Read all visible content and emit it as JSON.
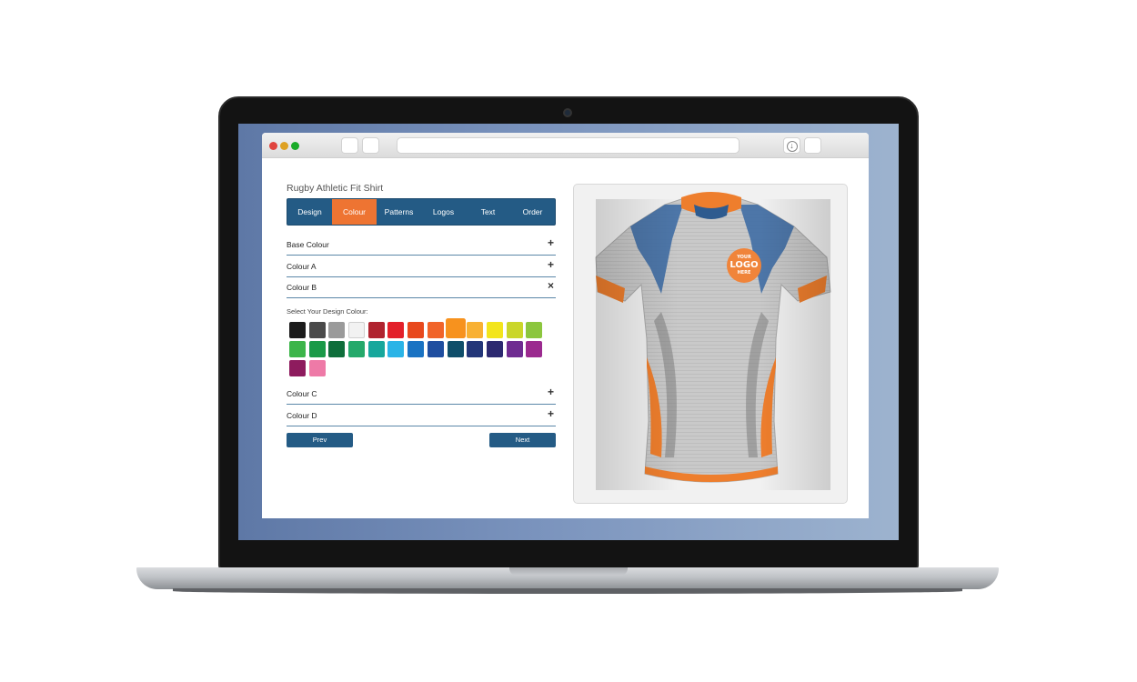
{
  "product": {
    "title": "Rugby Athletic Fit Shirt"
  },
  "tabs": [
    {
      "label": "Design",
      "active": false
    },
    {
      "label": "Colour",
      "active": true
    },
    {
      "label": "Patterns",
      "active": false
    },
    {
      "label": "Logos",
      "active": false
    },
    {
      "label": "Text",
      "active": false
    },
    {
      "label": "Order",
      "active": false
    }
  ],
  "accordion": {
    "base": {
      "label": "Base Colour",
      "toggle": "+"
    },
    "a": {
      "label": "Colour A",
      "toggle": "+"
    },
    "b": {
      "label": "Colour B",
      "toggle": "×"
    },
    "c": {
      "label": "Colour C",
      "toggle": "+"
    },
    "d": {
      "label": "Colour D",
      "toggle": "+"
    }
  },
  "colour_b": {
    "prompt": "Select Your Design Colour:",
    "swatches": [
      "#1c1c1c",
      "#4a4a4a",
      "#9a9a9a",
      "#f2f2f2",
      "#b0232f",
      "#e3202a",
      "#e8491d",
      "#f1642a",
      "#f7921e",
      "#f8b133",
      "#f3e51c",
      "#cad62a",
      "#8cc63e",
      "#3cb54a",
      "#1a9a48",
      "#0f6e3b",
      "#25a96b",
      "#17a79c",
      "#2ab4e7",
      "#1a73c3",
      "#1f4ea0",
      "#0f4e6a",
      "#233679",
      "#2c2970",
      "#6f2c91",
      "#9b2a8f",
      "#8e1b5e",
      "#ee7aa7"
    ],
    "selected_index": 8
  },
  "buttons": {
    "prev": "Prev",
    "next": "Next"
  },
  "preview": {
    "logo_line1": "YOUR",
    "logo_line2": "LOGO",
    "logo_line3": "HERE"
  },
  "colors": {
    "primary": "#245b85",
    "accent": "#ee7432"
  }
}
